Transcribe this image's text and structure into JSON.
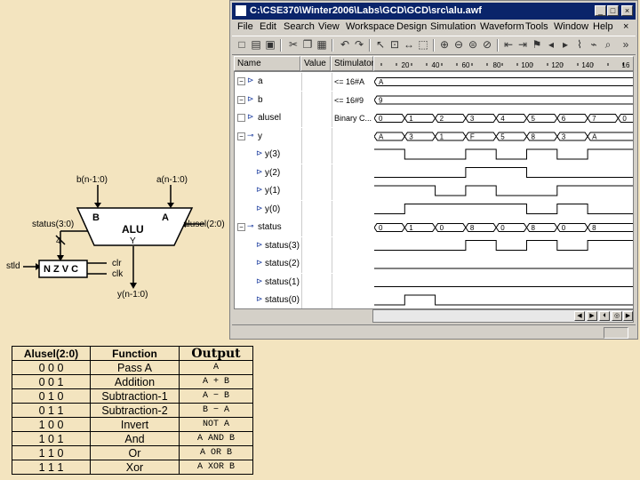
{
  "window": {
    "title": "C:\\CSE370\\Winter2006\\Labs\\GCD\\GCD\\src\\alu.awf",
    "menu": [
      "File",
      "Edit",
      "Search",
      "View",
      "Workspace",
      "Design",
      "Simulation",
      "Waveform",
      "Tools",
      "Window",
      "Help"
    ],
    "columns": {
      "name": "Name",
      "value": "Value",
      "stimulator": "Stimulator"
    },
    "ruler_ticks": [
      "20",
      "40",
      "60",
      "80",
      "100",
      "120",
      "140",
      "16"
    ],
    "signals": [
      {
        "name": "a",
        "stim": "<= 16#A",
        "expand": "−",
        "kind": "in"
      },
      {
        "name": "b",
        "stim": "<= 16#9",
        "expand": "−",
        "kind": "in"
      },
      {
        "name": "alusel",
        "stim": "Binary C...",
        "expand": "□",
        "kind": "in"
      },
      {
        "name": "y",
        "stim": "",
        "expand": "−",
        "kind": "out"
      },
      {
        "name": "y(3)",
        "stim": "",
        "expand": "",
        "kind": "sub"
      },
      {
        "name": "y(2)",
        "stim": "",
        "expand": "",
        "kind": "sub"
      },
      {
        "name": "y(1)",
        "stim": "",
        "expand": "",
        "kind": "sub"
      },
      {
        "name": "y(0)",
        "stim": "",
        "expand": "",
        "kind": "sub"
      },
      {
        "name": "status",
        "stim": "",
        "expand": "−",
        "kind": "out"
      },
      {
        "name": "status(3)",
        "stim": "",
        "expand": "",
        "kind": "sub"
      },
      {
        "name": "status(2)",
        "stim": "",
        "expand": "",
        "kind": "sub"
      },
      {
        "name": "status(1)",
        "stim": "",
        "expand": "",
        "kind": "sub"
      },
      {
        "name": "status(0)",
        "stim": "",
        "expand": "",
        "kind": "sub"
      }
    ],
    "bus_values": {
      "a": [
        "A"
      ],
      "b": [
        "9"
      ],
      "alusel": [
        "0",
        "1",
        "2",
        "3",
        "4",
        "5",
        "6",
        "7",
        "0"
      ],
      "y": [
        "A",
        "3",
        "1",
        "F",
        "5",
        "8",
        "3",
        "A"
      ],
      "status": [
        "0",
        "1",
        "0",
        "8",
        "0",
        "8",
        "0",
        "8"
      ]
    }
  },
  "diagram": {
    "b_in": "b(n-1:0)",
    "a_in": "a(n-1:0)",
    "b_port": "B",
    "a_port": "A",
    "alu_label": "ALU",
    "y_port": "Y",
    "status_label": "status(3:0)",
    "alusel_label": "alusel(2:0)",
    "bus_width": "4",
    "stld": "stld",
    "flags": "N Z V C",
    "clr": "clr",
    "clk": "clk",
    "y_out": "y(n-1:0)"
  },
  "table": {
    "headers": [
      "Alusel(2:0)",
      "Function",
      "Output"
    ],
    "rows": [
      [
        "0 0 0",
        "Pass A",
        "A"
      ],
      [
        "0 0 1",
        "Addition",
        "A + B"
      ],
      [
        "0 1 0",
        "Subtraction-1",
        "A − B"
      ],
      [
        "0 1 1",
        "Subtraction-2",
        "B − A"
      ],
      [
        "1 0 0",
        "Invert",
        "NOT A"
      ],
      [
        "1 0 1",
        "And",
        "A AND B"
      ],
      [
        "1 1 0",
        "Or",
        "A OR B"
      ],
      [
        "1 1 1",
        "Xor",
        "A XOR B"
      ]
    ]
  }
}
